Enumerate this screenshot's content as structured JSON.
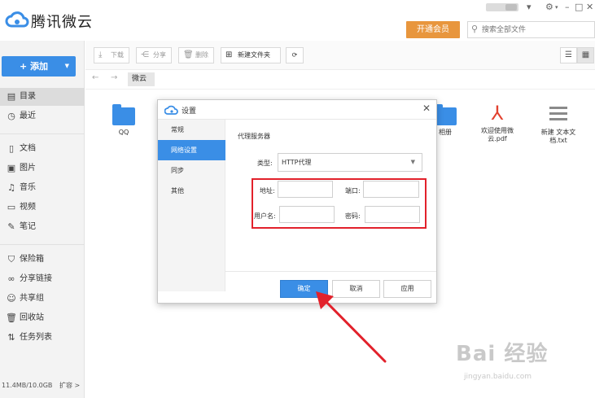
{
  "app": {
    "title": "腾讯微云",
    "vip_label": "开通会员",
    "search_placeholder": "搜索全部文件"
  },
  "toolbar": {
    "download": "下载",
    "share": "分享",
    "delete": "删除",
    "new_folder": "新建文件夹"
  },
  "breadcrumb": {
    "current": "微云"
  },
  "sidebar": {
    "add_label": "+ 添加",
    "items": [
      {
        "label": "目录",
        "icon": "directory-icon"
      },
      {
        "label": "最近",
        "icon": "clock-icon"
      },
      {
        "label": "文档",
        "icon": "document-icon"
      },
      {
        "label": "图片",
        "icon": "image-icon"
      },
      {
        "label": "音乐",
        "icon": "music-icon"
      },
      {
        "label": "视频",
        "icon": "video-icon"
      },
      {
        "label": "笔记",
        "icon": "note-icon"
      },
      {
        "label": "保险箱",
        "icon": "shield-icon"
      },
      {
        "label": "分享链接",
        "icon": "link-icon"
      },
      {
        "label": "共享组",
        "icon": "group-icon"
      },
      {
        "label": "回收站",
        "icon": "trash-icon"
      },
      {
        "label": "任务列表",
        "icon": "transfer-icon"
      }
    ],
    "quota": "11.4MB/10.0GB",
    "expand": "扩容 >"
  },
  "files": [
    {
      "name": "QQ",
      "type": "folder"
    },
    {
      "name": "相册",
      "type": "folder"
    },
    {
      "name": "欢迎使用微云.pdf",
      "line1": "欢迎使用微",
      "line2": "云.pdf",
      "type": "pdf"
    },
    {
      "name": "新建 文本文档.txt",
      "line1": "新建 文本文",
      "line2": "档.txt",
      "type": "txt"
    }
  ],
  "dialog": {
    "title": "设置",
    "tabs": [
      "常规",
      "网络设置",
      "同步",
      "其他"
    ],
    "active_tab": "网络设置",
    "section_title": "代理服务器",
    "type_label": "类型:",
    "type_value": "HTTP代理",
    "address_label": "地址:",
    "port_label": "端口:",
    "username_label": "用户名:",
    "password_label": "密码:",
    "address_value": "",
    "port_value": "",
    "username_value": "",
    "password_value": "",
    "ok": "确定",
    "cancel": "取消",
    "apply": "应用"
  },
  "watermark": {
    "text": "Bai 经验",
    "sub": "jingyan.baidu.com"
  },
  "colors": {
    "accent": "#3a8ee6",
    "vip": "#e8963d",
    "highlight": "#e2212b",
    "pdf": "#e2412f"
  }
}
